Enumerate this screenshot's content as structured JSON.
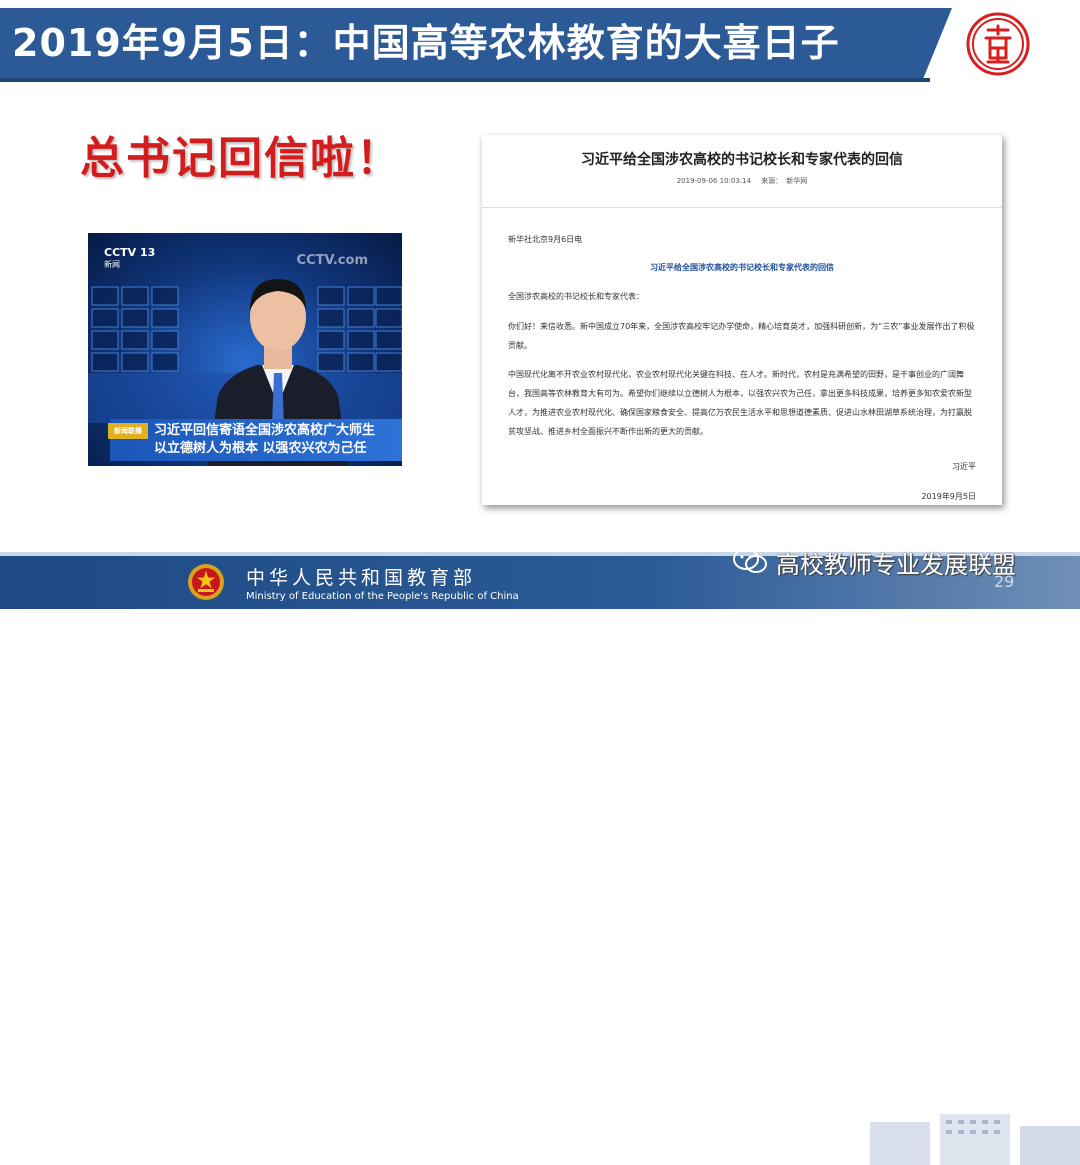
{
  "header": {
    "title": "2019年9月5日：中国高等农林教育的大喜日子",
    "logo_icon": "university-seal-icon"
  },
  "headline": "总书记回信啦！",
  "tv_screenshot": {
    "channel_logo": "CCTV 13",
    "channel_sub": "新闻",
    "watermark_logo": "CCTV.com",
    "badge": "新闻联播",
    "caption_line1": "习近平回信寄语全国涉农高校广大师生",
    "caption_line2": "以立德树人为根本 以强农兴农为己任"
  },
  "letter": {
    "title": "习近平给全国涉农高校的书记校长和专家代表的回信",
    "timestamp": "2019-09-06 10:03:14",
    "source_label": "来源：",
    "source_value": "新华网",
    "dateline": "新华社北京9月6日电",
    "heading": "习近平给全国涉农高校的书记校长和专家代表的回信",
    "salutation": "全国涉农高校的书记校长和专家代表：",
    "paragraph1": "你们好！来信收悉。新中国成立70年来，全国涉农高校牢记办学使命，精心培育英才，加强科研创新，为“三农”事业发展作出了积极贡献。",
    "paragraph2": "中国现代化离不开农业农村现代化，农业农村现代化关键在科技、在人才。新时代，农村是充满希望的田野，是干事创业的广阔舞台，我国高等农林教育大有可为。希望你们继续以立德树人为根本，以强农兴农为己任，拿出更多科技成果，培养更多知农爱农新型人才，为推进农业农村现代化、确保国家粮食安全、提高亿万农民生活水平和思想道德素质、促进山水林田湖草系统治理，为打赢脱贫攻坚战、推进乡村全面振兴不断作出新的更大的贡献。",
    "signature": "习近平",
    "date": "2019年9月5日"
  },
  "footer": {
    "ministry_cn": "中华人民共和国教育部",
    "ministry_en": "Ministry of Education of the People's Republic of China",
    "emblem_icon": "national-emblem-icon",
    "page_number": "29"
  },
  "watermark": {
    "icon": "wechat-icon",
    "text": "高校教师专业发展联盟"
  },
  "colors": {
    "header_blue": "#2b5a96",
    "headline_red": "#d31c1c",
    "letter_heading_blue": "#1e4e9a",
    "footer_blue": "#1e4a84"
  }
}
